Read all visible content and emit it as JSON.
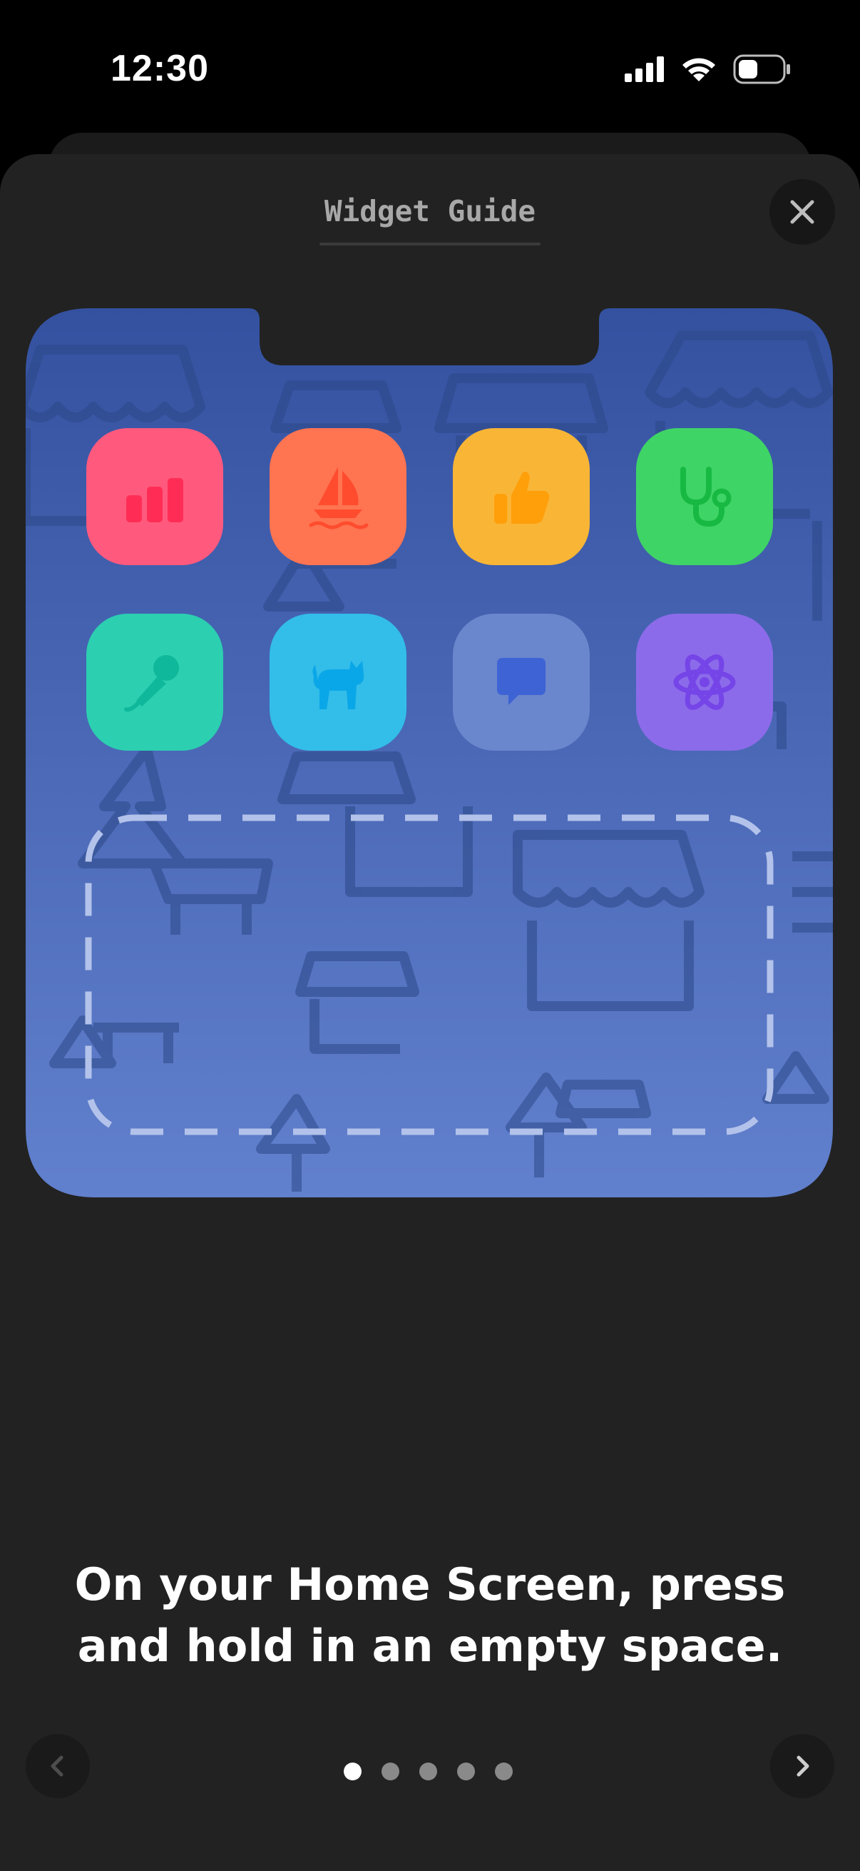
{
  "status_bar": {
    "time": "12:30",
    "icons": [
      "cellular-signal-icon",
      "wifi-icon",
      "battery-icon"
    ]
  },
  "sheet": {
    "title": "Widget Guide",
    "close_icon": "close-icon"
  },
  "illustration": {
    "background_gradient": [
      "#3451a0",
      "#6180cd"
    ],
    "apps": [
      {
        "name": "chart-app",
        "icon": "bar-chart-icon",
        "color": "#ff5a7e",
        "glyph_color": "#ff2d55"
      },
      {
        "name": "sailboat-app",
        "icon": "sailboat-icon",
        "color": "#ff7451",
        "glyph_color": "#ff4c2e"
      },
      {
        "name": "thumbs-up-app",
        "icon": "thumbs-up-icon",
        "color": "#f9b536",
        "glyph_color": "#ff9f0a"
      },
      {
        "name": "stethoscope-app",
        "icon": "stethoscope-icon",
        "color": "#3fd466",
        "glyph_color": "#17b942"
      },
      {
        "name": "microphone-app",
        "icon": "microphone-icon",
        "color": "#2ccfb0",
        "glyph_color": "#0fb89a"
      },
      {
        "name": "cat-app",
        "icon": "cat-icon",
        "color": "#33bde9",
        "glyph_color": "#0aa7e8"
      },
      {
        "name": "chat-app",
        "icon": "chat-bubble-icon",
        "color": "#6a86cd",
        "glyph_color": "#3e63d4"
      },
      {
        "name": "atom-app",
        "icon": "atom-icon",
        "color": "#8c6bea",
        "glyph_color": "#7545e8"
      }
    ],
    "widget_placeholder": "dashed-widget-placeholder"
  },
  "instruction": {
    "line1": "On your Home Screen, press",
    "line2": "and hold in an empty space."
  },
  "pagination": {
    "total": 5,
    "current": 1,
    "prev_icon": "chevron-left-icon",
    "next_icon": "chevron-right-icon"
  }
}
